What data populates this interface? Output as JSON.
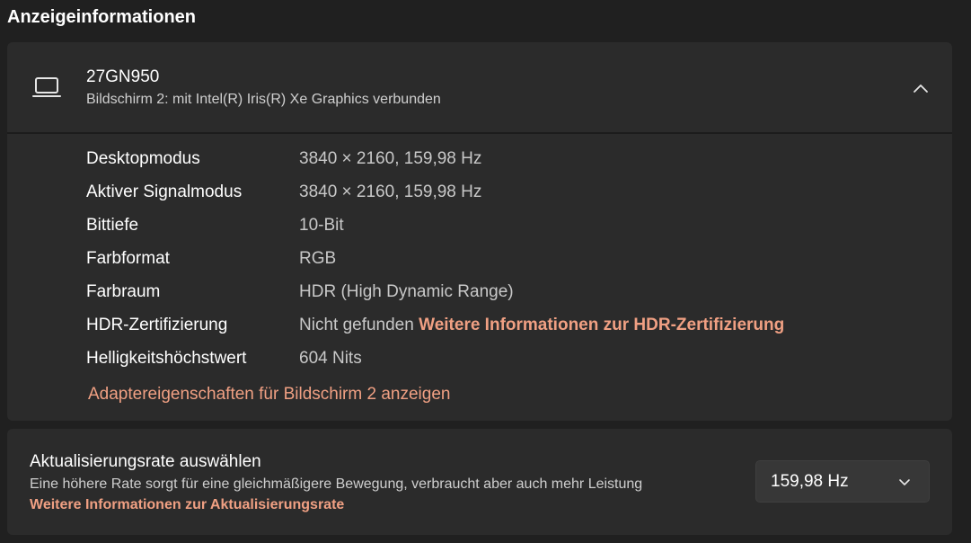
{
  "section": {
    "title": "Anzeigeinformationen"
  },
  "display": {
    "icon": "laptop-icon",
    "name": "27GN950",
    "subtitle": "Bildschirm 2: mit Intel(R) Iris(R) Xe Graphics verbunden",
    "expanded": true,
    "rows": [
      {
        "label": "Desktopmodus",
        "value": "3840 × 2160, 159,98 Hz"
      },
      {
        "label": "Aktiver Signalmodus",
        "value": "3840 × 2160, 159,98 Hz"
      },
      {
        "label": "Bittiefe",
        "value": "10-Bit"
      },
      {
        "label": "Farbformat",
        "value": "RGB"
      },
      {
        "label": "Farbraum",
        "value": "HDR (High Dynamic Range)"
      },
      {
        "label": "HDR-Zertifizierung",
        "value": "Nicht gefunden",
        "link": "Weitere Informationen zur HDR-Zertifizierung"
      },
      {
        "label": "Helligkeitshöchstwert",
        "value": "604 Nits"
      }
    ],
    "adapter_link": "Adaptereigenschaften für Bildschirm 2 anzeigen"
  },
  "refresh": {
    "title": "Aktualisierungsrate auswählen",
    "description": "Eine höhere Rate sorgt für eine gleichmäßigere Bewegung, verbraucht aber auch mehr Leistung",
    "link": "Weitere Informationen zur Aktualisierungsrate",
    "selected": "159,98 Hz"
  },
  "colors": {
    "background": "#202020",
    "card": "#2b2b2b",
    "accent_link": "#f0a083",
    "secondary_text": "#c8c8c8"
  }
}
